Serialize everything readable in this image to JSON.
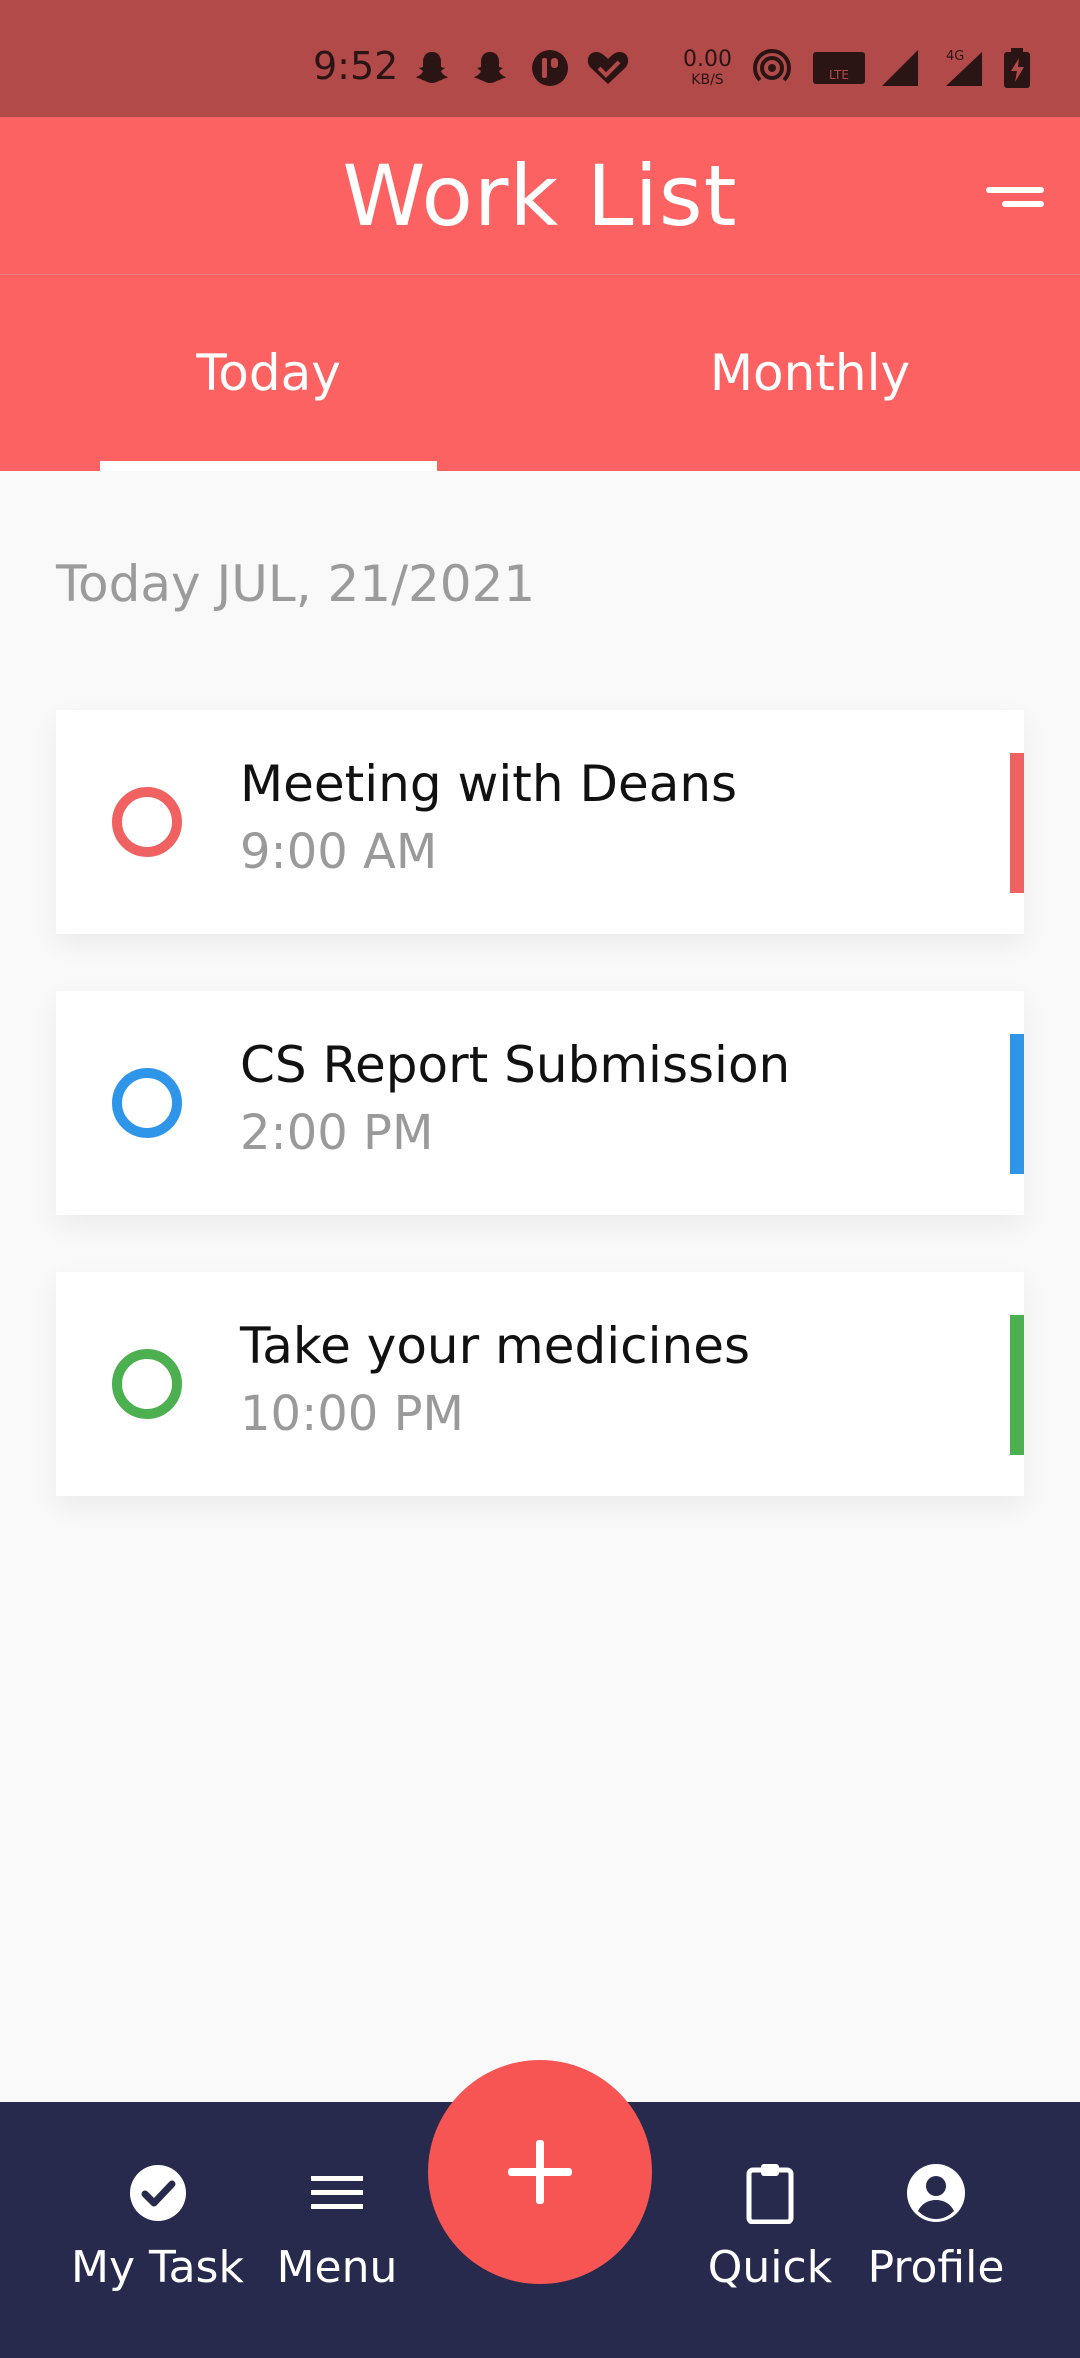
{
  "status_bar": {
    "time": "9:52",
    "net_speed": "0.00",
    "net_unit": "KB/S",
    "lte_badge": "LTE",
    "network_type": "4G",
    "icons": [
      "snapchat-icon",
      "snapchat-icon",
      "app-icon",
      "heart-check-icon",
      "hotspot-icon",
      "volte-icon",
      "signal-icon",
      "signal-4g-icon",
      "battery-icon"
    ]
  },
  "header": {
    "title": "Work List",
    "menu_icon": "sort-lines-icon"
  },
  "tabs": [
    {
      "label": "Today",
      "selected": true
    },
    {
      "label": "Monthly",
      "selected": false
    }
  ],
  "date_label": "Today JUL, 21/2021",
  "tasks": [
    {
      "title": "Meeting with Deans",
      "time": "9:00 AM",
      "color": "#f06262"
    },
    {
      "title": "CS Report Submission",
      "time": "2:00 PM",
      "color": "#2f95e8"
    },
    {
      "title": "Take your medicines",
      "time": "10:00 PM",
      "color": "#4caf50"
    }
  ],
  "bottom_nav": {
    "items": [
      {
        "label": "My Task",
        "icon": "check-circle-icon"
      },
      {
        "label": "Menu",
        "icon": "hamburger-icon"
      },
      {
        "label": "Quick",
        "icon": "clipboard-icon"
      },
      {
        "label": "Profile",
        "icon": "account-circle-icon"
      }
    ],
    "fab_icon": "plus-icon"
  },
  "colors": {
    "primary": "#fd6262",
    "status_bar": "#b34a4a",
    "nav_background": "#272a4d",
    "fab": "#f75553"
  }
}
